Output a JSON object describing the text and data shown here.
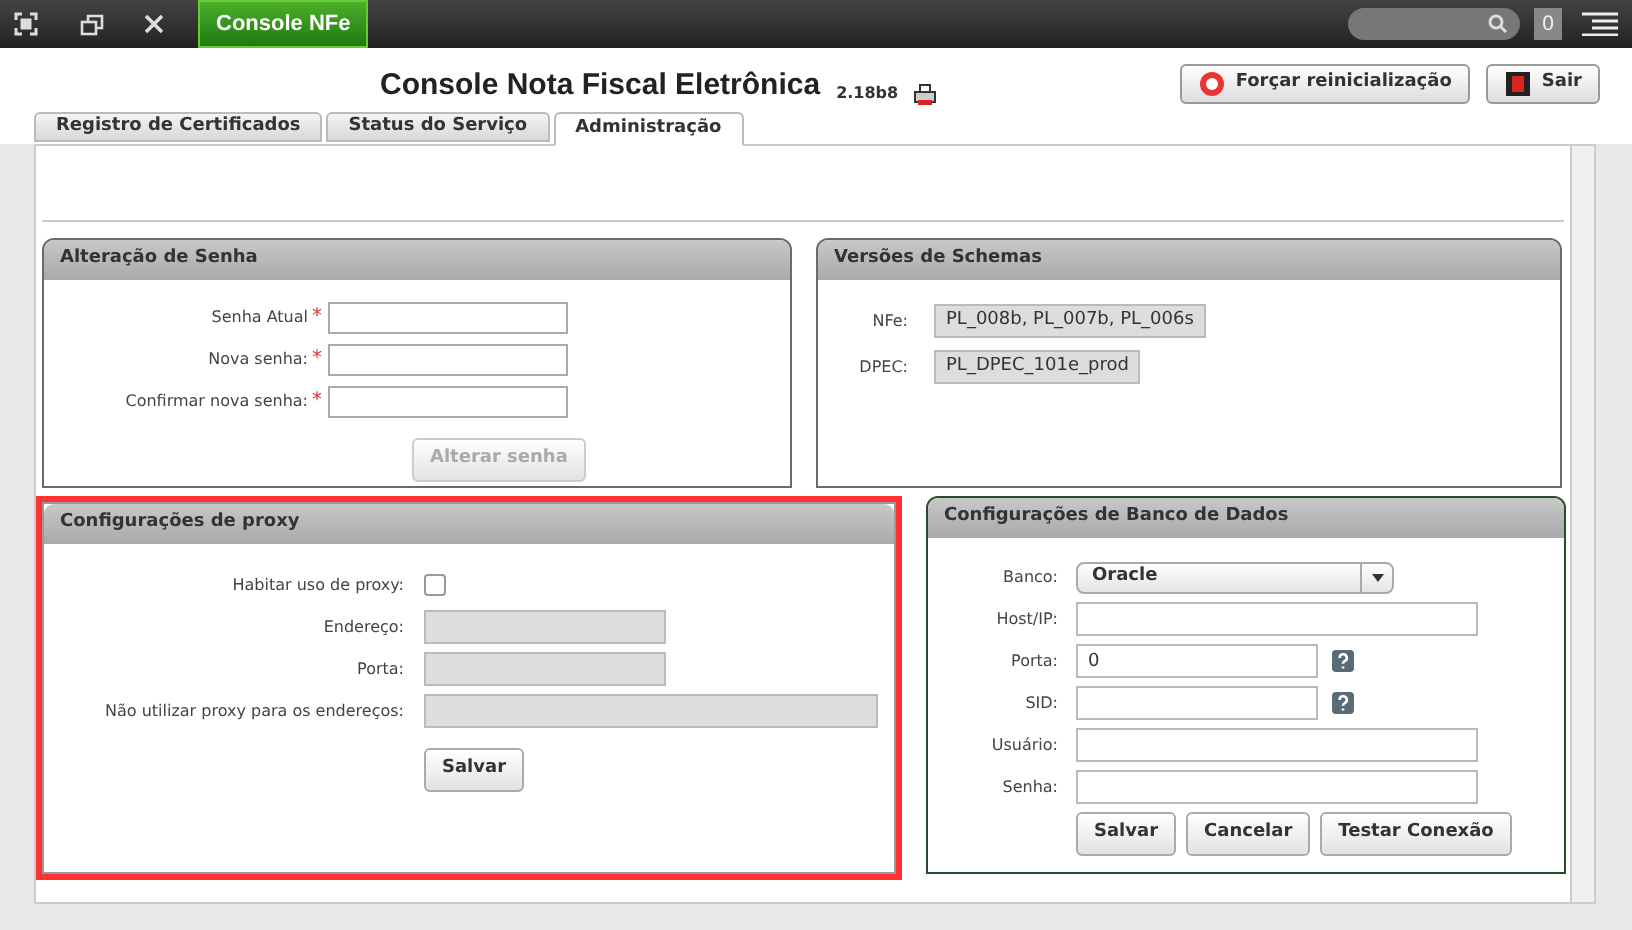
{
  "topbar": {
    "app_tab": "Console NFe",
    "badge": "0"
  },
  "header": {
    "title": "Console Nota Fiscal Eletrônica",
    "version": "2.18b8",
    "buttons": [
      {
        "label": "Forçar reinicialização",
        "kind": "restart"
      },
      {
        "label": "Sair",
        "kind": "exit"
      }
    ]
  },
  "tabs": [
    {
      "label": "Registro de Certificados",
      "selected": false
    },
    {
      "label": "Status do Serviço",
      "selected": false
    },
    {
      "label": "Administração",
      "selected": true
    }
  ],
  "password_panel": {
    "title": "Alteração de Senha",
    "fields": [
      {
        "label": "Senha Atual",
        "marker": "*"
      },
      {
        "label": "Nova senha:",
        "marker": "*"
      },
      {
        "label": "Confirmar nova senha:",
        "marker": "*"
      }
    ],
    "button": {
      "label": "Alterar senha",
      "disabled": true
    }
  },
  "schemas_panel": {
    "title": "Versões de Schemas",
    "fields": [
      {
        "label": "NFe:",
        "value": "PL_008b, PL_007b, PL_006s"
      },
      {
        "label": "DPEC:",
        "value": "PL_DPEC_101e_prod"
      }
    ]
  },
  "proxy_panel": {
    "title": "Configurações de proxy",
    "highlighted": true,
    "fields": [
      {
        "kind": "checkbox",
        "label": "Habitar uso de proxy:",
        "checked": false
      },
      {
        "kind": "text",
        "label": "Endereço:",
        "disabled": true
      },
      {
        "kind": "text",
        "label": "Porta:",
        "disabled": true
      },
      {
        "kind": "wide",
        "label": "Não utilizar proxy para os endereços:",
        "disabled": true
      }
    ],
    "button": {
      "label": "Salvar"
    }
  },
  "db_panel": {
    "title": "Configurações de Banco de Dados",
    "fields": [
      {
        "kind": "select",
        "label": "Banco:",
        "value": "Oracle"
      },
      {
        "kind": "text",
        "label": "Host/IP:"
      },
      {
        "kind": "short",
        "label": "Porta:",
        "value": "0",
        "help": true
      },
      {
        "kind": "short",
        "label": "SID:",
        "help": true
      },
      {
        "kind": "text",
        "label": "Usuário:"
      },
      {
        "kind": "text",
        "label": "Senha:"
      }
    ],
    "buttons": [
      "Salvar",
      "Cancelar",
      "Testar Conexão"
    ]
  }
}
